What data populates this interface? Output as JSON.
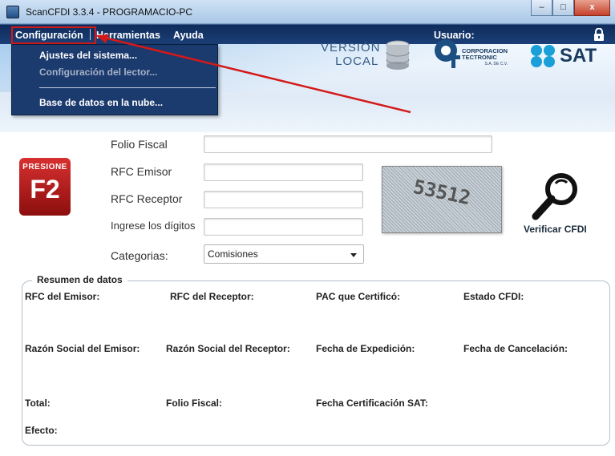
{
  "window": {
    "title": "ScanCFDI 3.3.4 - PROGRAMACIO-PC",
    "minimize": "–",
    "maximize": "□",
    "close": "x"
  },
  "menu": {
    "configuracion": "Configuración",
    "herramientas": "Herramientas",
    "ayuda": "Ayuda",
    "usuario": "Usuario:"
  },
  "dropdown": {
    "ajustes": "Ajustes del sistema...",
    "lector": "Configuración del lector...",
    "nube": "Base de datos en la nube..."
  },
  "banner": {
    "version_line1": "VERSIÓN",
    "version_line2": "LOCAL",
    "corp_line1": "CORPORACION",
    "corp_line2": "TECTRONIC",
    "corp_line3": "S.A. DE C.V.",
    "sat": "SAT"
  },
  "form": {
    "presione": "PRESIONE",
    "f2": "F2",
    "folio_fiscal": "Folio Fiscal",
    "rfc_emisor": "RFC Emisor",
    "rfc_receptor": "RFC Receptor",
    "digitos": "Ingrese los dígitos",
    "categorias": "Categorias:",
    "categoria_value": "Comisiones",
    "captcha_text": "53512",
    "verificar": "Verificar CFDI"
  },
  "resumen": {
    "title": "Resumen de datos",
    "rfc_emisor": "RFC del Emisor:",
    "rfc_receptor": "RFC del Receptor:",
    "pac": "PAC que Certificó:",
    "estado": "Estado CFDI:",
    "razon_emisor": "Razón Social del Emisor:",
    "razon_receptor": "Razón Social del Receptor:",
    "fecha_expedicion": "Fecha de Expedición:",
    "fecha_cancelacion": "Fecha de Cancelación:",
    "total": "Total:",
    "folio_fiscal": "Folio Fiscal:",
    "fecha_cert": "Fecha Certificación SAT:",
    "efecto": "Efecto:"
  },
  "colors": {
    "menubar": "#1b3f77",
    "highlight": "#d31919",
    "brand": "#183a5f"
  }
}
